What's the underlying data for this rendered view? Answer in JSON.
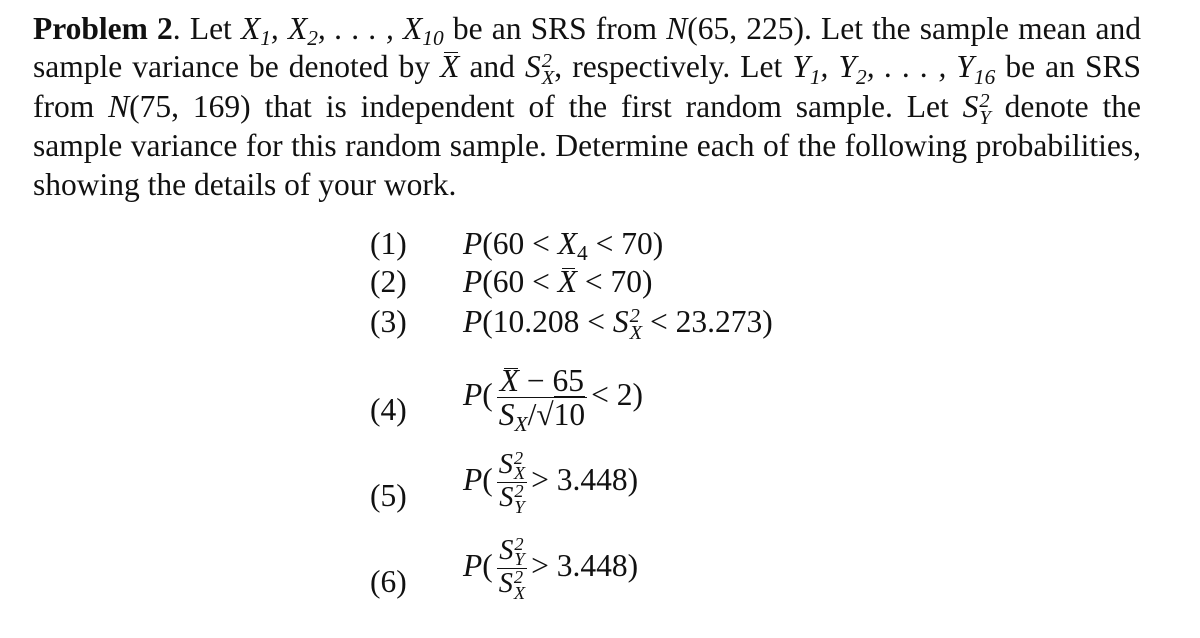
{
  "problem": {
    "label": "Problem 2",
    "intro_let": "Let",
    "x_seq": "X₁, X₂, . . . , X₁₀",
    "t1": "be an SRS from",
    "dist_x": "N(65, 225)",
    "t2": ". Let the sample mean and sample variance be denoted by",
    "t3": "and",
    "t4": ", respectively. Let",
    "y_seq": "Y₁, Y₂, . . . , Y₁₆",
    "t5": "be an SRS from",
    "dist_y": "N(75, 169)",
    "t6": "that is independent of the first random sample. Let",
    "t7": "denote the sample variance for this random sample. Determine each of the following probabilities, showing the details of your work."
  },
  "items": [
    {
      "num": "(1)",
      "expr": "P(60 < X₄ < 70)"
    },
    {
      "num": "(2)",
      "expr": "P(60 < X̄ < 70)"
    },
    {
      "num": "(3)",
      "expr_pre": "P(10.208 <",
      "expr_post": "< 23.273)"
    },
    {
      "num": "(4)",
      "numerator": "X̄ − 65",
      "denominator": "Sₓ/√10",
      "tail": "< 2)"
    },
    {
      "num": "(5)",
      "numerator": "S²ₓ",
      "denominator": "S²ᵧ",
      "tail": "> 3.448)"
    },
    {
      "num": "(6)",
      "numerator": "S²ᵧ",
      "denominator": "S²ₓ",
      "tail": "> 3.448)"
    }
  ]
}
